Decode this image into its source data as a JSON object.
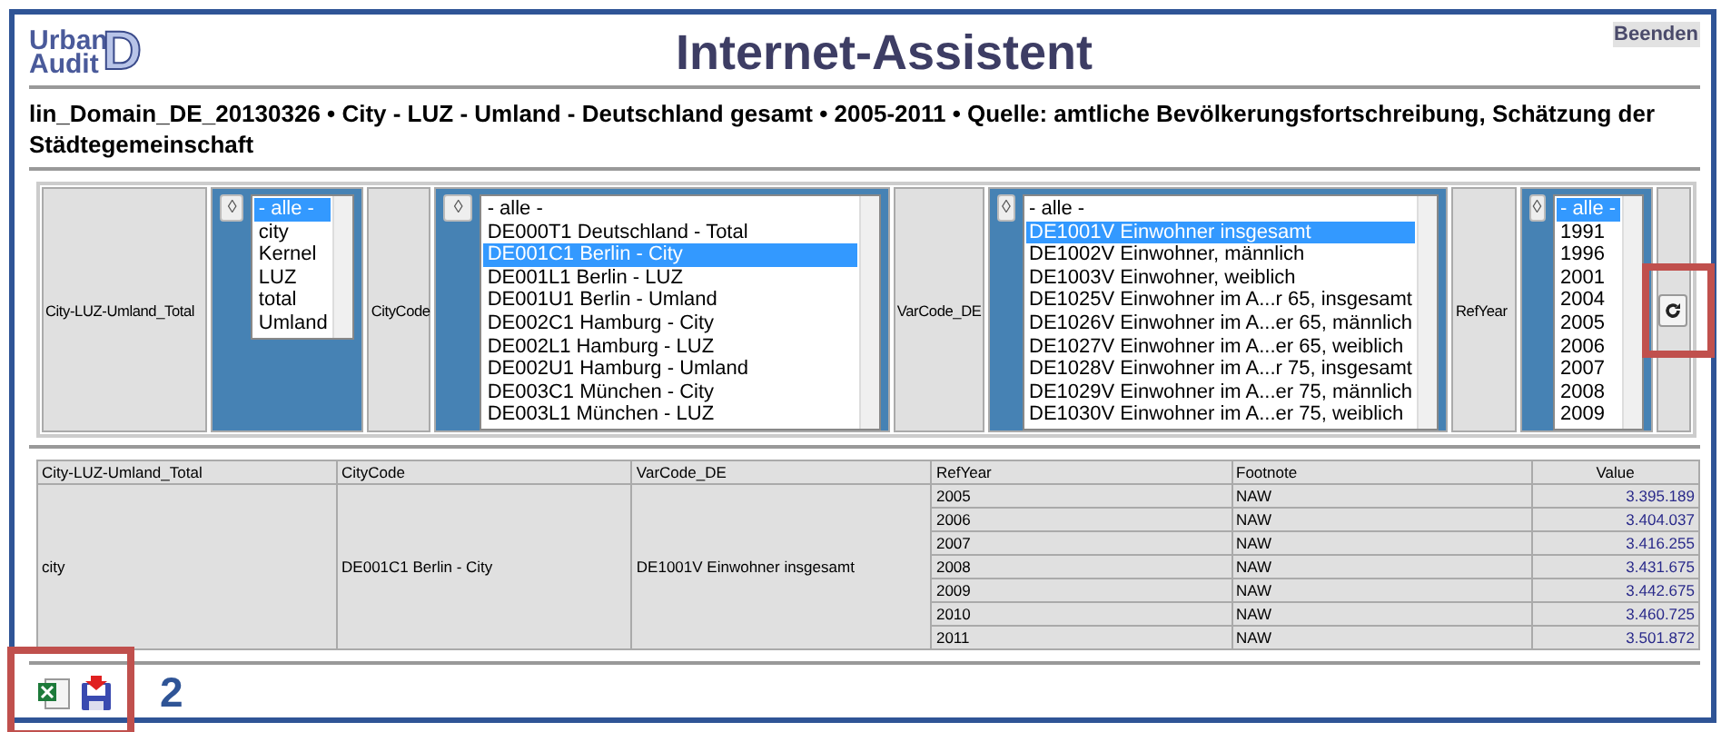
{
  "logo": {
    "line_1": "Urban",
    "line_2": "Audit",
    "letter": "D"
  },
  "title": "Internet-Assistent",
  "exit_button": "Beenden",
  "subtitle": "lin_Domain_DE_20130326 • City - LUZ - Umland - Deutschland gesamt • 2005-2011 • Quelle: amtliche Bevölkerungsfortschreibung, Schätzung der Städtegemeinschaft",
  "filters": [
    {
      "label": "City-LUZ-Umland_Total",
      "sort_button": "◊",
      "items": [
        {
          "text": "- alle -",
          "selected": true
        },
        {
          "text": "city",
          "selected": false
        },
        {
          "text": "Kernel",
          "selected": false
        },
        {
          "text": "LUZ",
          "selected": false
        },
        {
          "text": "total",
          "selected": false
        },
        {
          "text": "Umland",
          "selected": false
        }
      ]
    },
    {
      "label": "CityCode",
      "sort_button": "◊",
      "items": [
        {
          "text": "- alle -",
          "selected": false
        },
        {
          "text": "DE000T1 Deutschland - Total",
          "selected": false
        },
        {
          "text": "DE001C1 Berlin - City",
          "selected": true
        },
        {
          "text": "DE001L1 Berlin - LUZ",
          "selected": false
        },
        {
          "text": "DE001U1 Berlin - Umland",
          "selected": false
        },
        {
          "text": "DE002C1 Hamburg - City",
          "selected": false
        },
        {
          "text": "DE002L1 Hamburg - LUZ",
          "selected": false
        },
        {
          "text": "DE002U1 Hamburg - Umland",
          "selected": false
        },
        {
          "text": "DE003C1 München - City",
          "selected": false
        },
        {
          "text": "DE003L1 München - LUZ",
          "selected": false
        }
      ]
    },
    {
      "label": "VarCode_DE",
      "sort_button": "◊",
      "items": [
        {
          "text": "- alle -",
          "selected": false
        },
        {
          "text": "DE1001V Einwohner insgesamt",
          "selected": true
        },
        {
          "text": "DE1002V Einwohner, männlich",
          "selected": false
        },
        {
          "text": "DE1003V Einwohner, weiblich",
          "selected": false
        },
        {
          "text": "DE1025V Einwohner im A...r 65, insgesamt",
          "selected": false
        },
        {
          "text": "DE1026V Einwohner im A...er 65, männlich",
          "selected": false
        },
        {
          "text": "DE1027V Einwohner im A...er 65, weiblich",
          "selected": false
        },
        {
          "text": "DE1028V Einwohner im A...r 75, insgesamt",
          "selected": false
        },
        {
          "text": "DE1029V Einwohner im A...er 75, männlich",
          "selected": false
        },
        {
          "text": "DE1030V Einwohner im A...er 75, weiblich",
          "selected": false
        }
      ]
    },
    {
      "label": "RefYear",
      "sort_button": "◊",
      "items": [
        {
          "text": "- alle -",
          "selected": true
        },
        {
          "text": "1991",
          "selected": false
        },
        {
          "text": "1996",
          "selected": false
        },
        {
          "text": "2001",
          "selected": false
        },
        {
          "text": "2004",
          "selected": false
        },
        {
          "text": "2005",
          "selected": false
        },
        {
          "text": "2006",
          "selected": false
        },
        {
          "text": "2007",
          "selected": false
        },
        {
          "text": "2008",
          "selected": false
        },
        {
          "text": "2009",
          "selected": false
        }
      ]
    }
  ],
  "table": {
    "columns": [
      "City-LUZ-Umland_Total",
      "CityCode",
      "VarCode_DE",
      "RefYear",
      "Footnote",
      "Value"
    ],
    "group": {
      "city_type": "city",
      "city_code": "DE001C1 Berlin - City",
      "var_code": "DE1001V Einwohner insgesamt"
    },
    "rows": [
      {
        "year": "2005",
        "footnote": "NAW",
        "value": "3.395.189"
      },
      {
        "year": "2006",
        "footnote": "NAW",
        "value": "3.404.037"
      },
      {
        "year": "2007",
        "footnote": "NAW",
        "value": "3.416.255"
      },
      {
        "year": "2008",
        "footnote": "NAW",
        "value": "3.431.675"
      },
      {
        "year": "2009",
        "footnote": "NAW",
        "value": "3.442.675"
      },
      {
        "year": "2010",
        "footnote": "NAW",
        "value": "3.460.725"
      },
      {
        "year": "2011",
        "footnote": "NAW",
        "value": "3.501.872"
      }
    ]
  },
  "callout_number": "2"
}
